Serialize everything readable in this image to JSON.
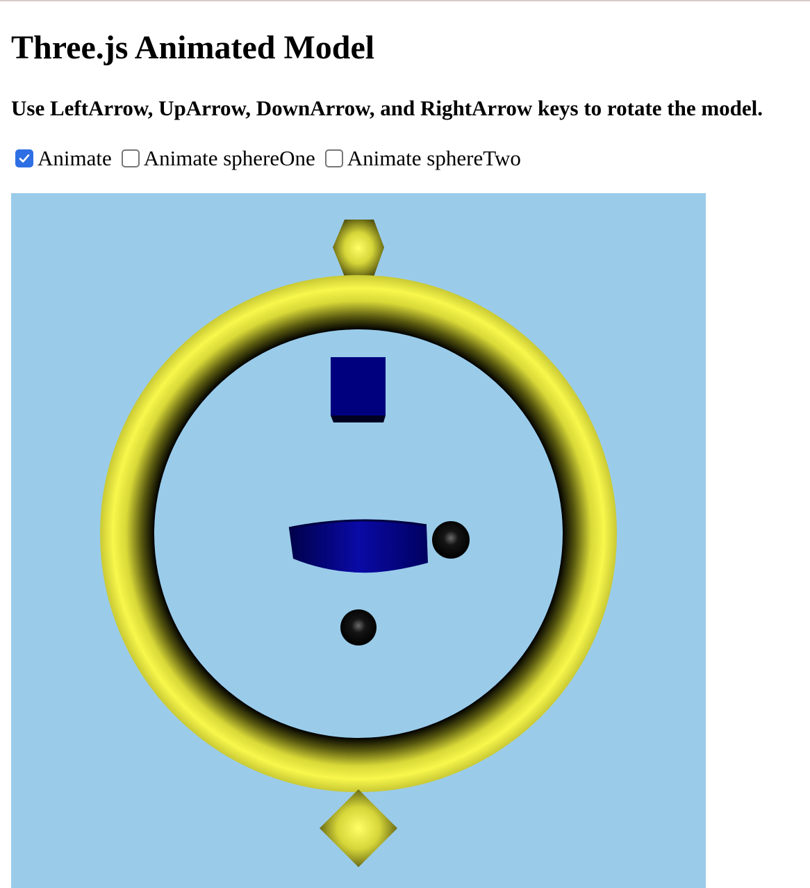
{
  "page": {
    "title": "Three.js Animated Model",
    "instructions": "Use LeftArrow, UpArrow, DownArrow, and RightArrow keys to rotate the model."
  },
  "controls": [
    {
      "label": "Animate",
      "checked": true
    },
    {
      "label": "Animate sphereOne",
      "checked": false
    },
    {
      "label": "Animate sphereTwo",
      "checked": false
    }
  ],
  "scene": {
    "background": "#9accea",
    "torus_color": "#f2f24a",
    "cube_color": "#00007e",
    "cylinder_color": "#00007e",
    "sphere_color": "#000000",
    "checkbox_accent": "#2f6fe4"
  }
}
